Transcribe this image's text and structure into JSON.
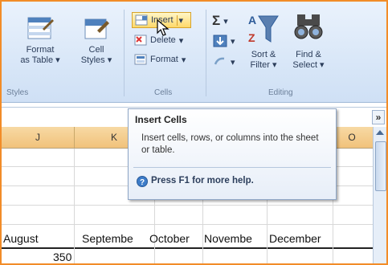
{
  "ribbon": {
    "styles_group": {
      "format_as_table": {
        "line1": "Format",
        "line2": "as Table ▾"
      },
      "cell_styles": {
        "line1": "Cell",
        "line2": "Styles ▾"
      },
      "group_label": "Styles"
    },
    "cells_group": {
      "insert": "Insert",
      "delete": "Delete",
      "format": "Format",
      "dropdown_arrow": "▾",
      "group_label": "Cells"
    },
    "editing_group": {
      "sum_symbol": "Σ",
      "sum_arrow": "▾",
      "sort_filter": {
        "line1": "Sort &",
        "line2": "Filter ▾"
      },
      "find_select": {
        "line1": "Find &",
        "line2": "Select ▾"
      },
      "group_label": "Editing"
    }
  },
  "formula_bar": {
    "expand_symbol": "»"
  },
  "columns": [
    "J",
    "K",
    "O"
  ],
  "row_header_cells": [
    "August",
    "Septembe",
    "October",
    "Novembe",
    "December"
  ],
  "value_row": [
    "350"
  ],
  "tooltip": {
    "title": "Insert Cells",
    "body": "Insert cells, rows, or columns into the sheet or table.",
    "help": "Press F1 for more help."
  },
  "colors": {
    "accent_border": "#f28c28",
    "ribbon_bg": "#d6e5f7",
    "highlight": "#ffd96a"
  }
}
